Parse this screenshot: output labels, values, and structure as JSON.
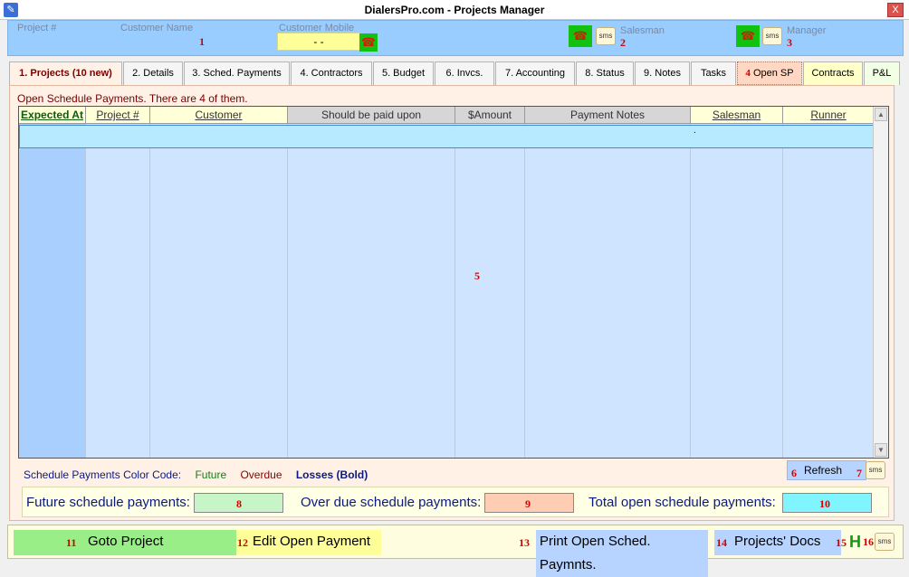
{
  "window": {
    "title": "DialersPro.com - Projects Manager",
    "close_glyph": "X"
  },
  "header": {
    "project_label": "Project #",
    "customer_name_label": "Customer Name",
    "customer_mobile_label": "Customer Mobile",
    "customer_mobile_value": "-  -",
    "salesman_label": "Salesman",
    "manager_label": "Manager",
    "marker_1": "1",
    "marker_2": "2",
    "marker_3": "3",
    "sms_label": "sms"
  },
  "tabs": [
    {
      "label": "1. Projects (10 new)"
    },
    {
      "label": "2. Details"
    },
    {
      "label": "3. Sched. Payments"
    },
    {
      "label": "4. Contractors"
    },
    {
      "label": "5. Budget"
    },
    {
      "label": "6. Invcs."
    },
    {
      "label": "7. Accounting"
    },
    {
      "label": "8. Status"
    },
    {
      "label": "9. Notes"
    },
    {
      "label": "Tasks"
    },
    {
      "label": "Open SP",
      "marker": "4"
    },
    {
      "label": "Contracts"
    },
    {
      "label": "P&L"
    }
  ],
  "panel": {
    "caption": "Open Schedule Payments. There are 4 of them."
  },
  "grid": {
    "columns": [
      "Expected At",
      "Project #",
      "Customer",
      "Should be paid upon",
      "$Amount",
      "Payment Notes",
      "Salesman",
      "Runner"
    ],
    "row_dot": ".",
    "marker_5": "5"
  },
  "legend": {
    "label": "Schedule Payments Color Code:",
    "future": "Future",
    "overdue": "Overdue",
    "losses": "Losses (Bold)",
    "colors": {
      "future": "#1a7a1a",
      "overdue": "#8a0000",
      "losses": "#0a1a80"
    }
  },
  "refresh": {
    "marker": "6",
    "label": "Refresh",
    "sms_marker": "7",
    "sms_label": "sms"
  },
  "totals": {
    "future_label": "Future schedule payments:",
    "future_marker": "8",
    "overdue_label": "Over due schedule payments:",
    "overdue_marker": "9",
    "total_label": "Total open schedule payments:",
    "total_marker": "10"
  },
  "bottom": {
    "goto_marker": "11",
    "goto_label": "Goto Project",
    "edit_marker": "12",
    "edit_label": "Edit Open Payment",
    "print_marker": "13",
    "print_label": "Print Open Sched. Paymnts.",
    "docs_marker": "14",
    "docs_label": "Projects' Docs",
    "h_marker": "15",
    "h_label": "H",
    "sms_marker": "16",
    "sms_label": "sms"
  }
}
